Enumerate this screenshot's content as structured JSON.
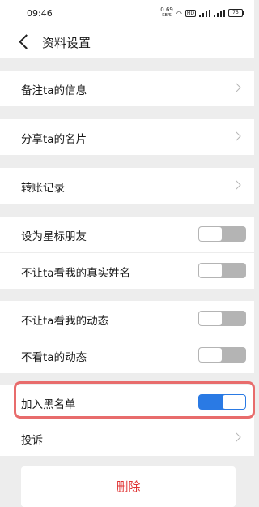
{
  "status_bar": {
    "time": "09:46",
    "speed_value": "0.69",
    "speed_unit": "KB/S",
    "battery": "75"
  },
  "header": {
    "title": "资料设置"
  },
  "rows": {
    "remark": "备注ta的信息",
    "share_card": "分享ta的名片",
    "transfer_records": "转账记录",
    "star_friend": "设为星标朋友",
    "hide_real_name": "不让ta看我的真实姓名",
    "hide_my_moments": "不让ta看我的动态",
    "hide_their_moments": "不看ta的动态",
    "blacklist": "加入黑名单",
    "complain": "投诉"
  },
  "toggles": {
    "star_friend": false,
    "hide_real_name": false,
    "hide_my_moments": false,
    "hide_their_moments": false,
    "blacklist": true
  },
  "delete_label": "删除",
  "colors": {
    "accent": "#2a7ae4",
    "danger": "#e03333",
    "highlight": "#e86c6c",
    "background": "#ededed"
  }
}
